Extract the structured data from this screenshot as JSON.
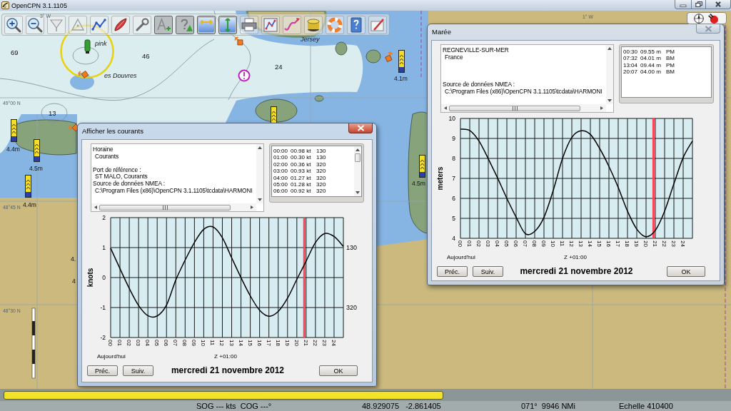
{
  "window": {
    "title": "OpenCPN 3.1.1105"
  },
  "toolbar": {
    "items": [
      {
        "kind": "zoomin",
        "on": false
      },
      {
        "kind": "zoomout",
        "on": false
      },
      {
        "kind": "scaledown",
        "on": false
      },
      {
        "kind": "scaleup",
        "on": false
      },
      {
        "kind": "route",
        "on": false
      },
      {
        "kind": "follow",
        "on": false
      },
      {
        "kind": "settings",
        "on": false
      },
      {
        "kind": "text",
        "on": true
      },
      {
        "kind": "query",
        "on": true
      },
      {
        "kind": "tides",
        "on": true
      },
      {
        "kind": "currents",
        "on": true
      },
      {
        "kind": "print",
        "on": false
      },
      {
        "kind": "routes",
        "on": false
      },
      {
        "kind": "track",
        "on": false
      },
      {
        "kind": "layers",
        "on": false
      },
      {
        "kind": "mob",
        "on": false
      },
      {
        "kind": "help",
        "on": false
      },
      {
        "kind": "about",
        "on": false
      }
    ]
  },
  "map": {
    "labels": [
      {
        "text": "69",
        "kind": "depth"
      },
      {
        "text": "46",
        "kind": "depth"
      },
      {
        "text": "24",
        "kind": "depth"
      },
      {
        "text": "13",
        "kind": "depth"
      },
      {
        "text": "pink",
        "kind": "place"
      },
      {
        "text": "es Douvres",
        "kind": "place"
      },
      {
        "text": "Jersey",
        "kind": "place"
      },
      {
        "text": "49°00 N",
        "kind": "grid"
      },
      {
        "text": "48°45 N",
        "kind": "grid"
      },
      {
        "text": "48°30 N",
        "kind": "grid"
      },
      {
        "text": "3° W",
        "kind": "grid"
      },
      {
        "text": "1° W",
        "kind": "grid"
      },
      {
        "text": "4.4m",
        "kind": "height"
      },
      {
        "text": "4.5m",
        "kind": "height"
      },
      {
        "text": "4.4m",
        "kind": "height"
      },
      {
        "text": "4.1m",
        "kind": "height"
      },
      {
        "text": "4.5m",
        "kind": "height"
      },
      {
        "text": "4.",
        "kind": "height"
      },
      {
        "text": "4",
        "kind": "height"
      }
    ]
  },
  "currents_dialog": {
    "title": "Afficher les courants",
    "active": true,
    "info_groups": [
      [
        {
          "text": "Horaine",
          "indented": false
        },
        {
          "text": "Courants",
          "indented": true
        }
      ],
      [
        {
          "text": "Port de référence :",
          "indented": false
        },
        {
          "text": "ST MALO, Courants",
          "indented": true
        },
        {
          "text": "Source de données NMEA :",
          "indented": false
        },
        {
          "text": "C:\\Program Files (x86)\\OpenCPN 3.1.1105\\tcdata\\HARMONI",
          "indented": true
        }
      ]
    ],
    "readings": [
      {
        "time": "00:00",
        "speed": "00.98 kt",
        "direction": "130"
      },
      {
        "time": "01:00",
        "speed": "00.30 kt",
        "direction": "130"
      },
      {
        "time": "02:00",
        "speed": "00.36 kt",
        "direction": "320"
      },
      {
        "time": "03:00",
        "speed": "00.93 kt",
        "direction": "320"
      },
      {
        "time": "04:00",
        "speed": "01.27 kt",
        "direction": "320"
      },
      {
        "time": "05:00",
        "speed": "01.28 kt",
        "direction": "320"
      },
      {
        "time": "06:00",
        "speed": "00.92 kt",
        "direction": "320"
      }
    ],
    "chart_data": {
      "type": "line",
      "ylabel": "knots",
      "xlabel": "Z +01:00",
      "x": [
        0,
        1,
        2,
        3,
        4,
        5,
        6,
        7,
        8,
        9,
        10,
        11,
        12,
        13,
        14,
        15,
        16,
        17,
        18,
        19,
        20,
        21,
        22,
        23,
        24,
        25
      ],
      "values": [
        0.98,
        0.3,
        -0.36,
        -0.93,
        -1.27,
        -1.28,
        -0.92,
        -0.08,
        0.58,
        1.17,
        1.61,
        1.69,
        1.33,
        0.66,
        0.0,
        -0.61,
        -1.09,
        -1.29,
        -1.13,
        -0.69,
        -0.06,
        0.55,
        1.17,
        1.47,
        1.37,
        1.04
      ],
      "xlim": [
        0,
        25
      ],
      "ylim": [
        -2,
        2
      ],
      "xticks": [
        {
          "value": 0,
          "label": "00"
        },
        {
          "value": 1,
          "label": "01"
        },
        {
          "value": 2,
          "label": "02"
        },
        {
          "value": 3,
          "label": "03"
        },
        {
          "value": 4,
          "label": "04"
        },
        {
          "value": 5,
          "label": "05"
        },
        {
          "value": 6,
          "label": "06"
        },
        {
          "value": 7,
          "label": "07"
        },
        {
          "value": 8,
          "label": "08"
        },
        {
          "value": 9,
          "label": "09"
        },
        {
          "value": 10,
          "label": "10"
        },
        {
          "value": 11,
          "label": "11"
        },
        {
          "value": 12,
          "label": "12"
        },
        {
          "value": 13,
          "label": "13"
        },
        {
          "value": 14,
          "label": "14"
        },
        {
          "value": 15,
          "label": "15"
        },
        {
          "value": 16,
          "label": "16"
        },
        {
          "value": 17,
          "label": "17"
        },
        {
          "value": 18,
          "label": "18"
        },
        {
          "value": 19,
          "label": "19"
        },
        {
          "value": 20,
          "label": "20"
        },
        {
          "value": 21,
          "label": "21"
        },
        {
          "value": 22,
          "label": "22"
        },
        {
          "value": 23,
          "label": "23"
        },
        {
          "value": 24,
          "label": "24"
        }
      ],
      "yticks": [
        -2,
        -1,
        0,
        1,
        2
      ],
      "grid": true,
      "ref_lines": [
        {
          "axis": "x",
          "value": 20.8,
          "color": "#ff4458"
        }
      ],
      "annotations": [
        "130",
        "320"
      ]
    },
    "today_label": "Aujourd'hui",
    "date": "mercredi 21 novembre 2012",
    "buttons": [
      {
        "label": "Préc."
      },
      {
        "label": "Suiv."
      },
      {
        "label": "OK"
      }
    ]
  },
  "tide_dialog": {
    "title": "Marée",
    "active": false,
    "info_groups": [
      [
        {
          "text": "REGNEVILLE-SUR-MER",
          "indented": false
        },
        {
          "text": "France",
          "indented": true
        }
      ],
      [
        {
          "text": "Source de données NMEA :",
          "indented": false
        },
        {
          "text": "C:\\Program Files (x86)\\OpenCPN 3.1.1105\\tcdata\\HARMONI",
          "indented": true
        }
      ]
    ],
    "events": [
      {
        "time": "00:30",
        "height": "09.55 m",
        "type": "PM"
      },
      {
        "time": "07:32",
        "height": "04.01 m",
        "type": "BM"
      },
      {
        "time": "13:04",
        "height": "09.44 m",
        "type": "PM"
      },
      {
        "time": "20:07",
        "height": "04.00 m",
        "type": "BM"
      }
    ],
    "chart_data": {
      "type": "line",
      "ylabel": "meters",
      "xlabel": "Z +01:00",
      "x": [
        0,
        1,
        2,
        3,
        4,
        5,
        6,
        7,
        8,
        9,
        10,
        11,
        12,
        13,
        14,
        15,
        16,
        17,
        18,
        19,
        20,
        21,
        22,
        23,
        24,
        25
      ],
      "values": [
        9.47,
        9.4,
        8.87,
        7.98,
        7.02,
        6.0,
        5.06,
        4.23,
        4.35,
        5.05,
        6.4,
        8.0,
        9.05,
        9.38,
        9.2,
        8.5,
        7.6,
        6.55,
        5.36,
        4.46,
        4.08,
        4.4,
        5.36,
        6.73,
        8.04,
        8.87
      ],
      "xlim": [
        0,
        25
      ],
      "ylim": [
        4,
        10
      ],
      "xticks": [
        {
          "value": 0,
          "label": "00"
        },
        {
          "value": 1,
          "label": "01"
        },
        {
          "value": 2,
          "label": "02"
        },
        {
          "value": 3,
          "label": "03"
        },
        {
          "value": 4,
          "label": "04"
        },
        {
          "value": 5,
          "label": "05"
        },
        {
          "value": 6,
          "label": "06"
        },
        {
          "value": 7,
          "label": "07"
        },
        {
          "value": 8,
          "label": "08"
        },
        {
          "value": 9,
          "label": "09"
        },
        {
          "value": 10,
          "label": "10"
        },
        {
          "value": 11,
          "label": "11"
        },
        {
          "value": 12,
          "label": "12"
        },
        {
          "value": 13,
          "label": "13"
        },
        {
          "value": 14,
          "label": "14"
        },
        {
          "value": 15,
          "label": "15"
        },
        {
          "value": 16,
          "label": "16"
        },
        {
          "value": 17,
          "label": "17"
        },
        {
          "value": 18,
          "label": "18"
        },
        {
          "value": 19,
          "label": "19"
        },
        {
          "value": 20,
          "label": "20"
        },
        {
          "value": 21,
          "label": "21"
        },
        {
          "value": 22,
          "label": "22"
        },
        {
          "value": 23,
          "label": "23"
        },
        {
          "value": 24,
          "label": "24"
        }
      ],
      "yticks": [
        4,
        5,
        6,
        7,
        8,
        9,
        10
      ],
      "grid": true,
      "ref_lines": [
        {
          "axis": "x",
          "value": 20.8,
          "color": "#ff4458"
        }
      ]
    },
    "today_label": "Aujourd'hui",
    "date": "mercredi 21 novembre 2012",
    "buttons": [
      {
        "label": "Préc."
      },
      {
        "label": "Suiv."
      },
      {
        "label": "OK"
      }
    ]
  },
  "status_bar": {
    "readouts": [
      "SOG --- kts  COG ---°",
      "48.929075   -2.861405",
      "071°  9946 NMi",
      "Echelle 410400"
    ]
  }
}
